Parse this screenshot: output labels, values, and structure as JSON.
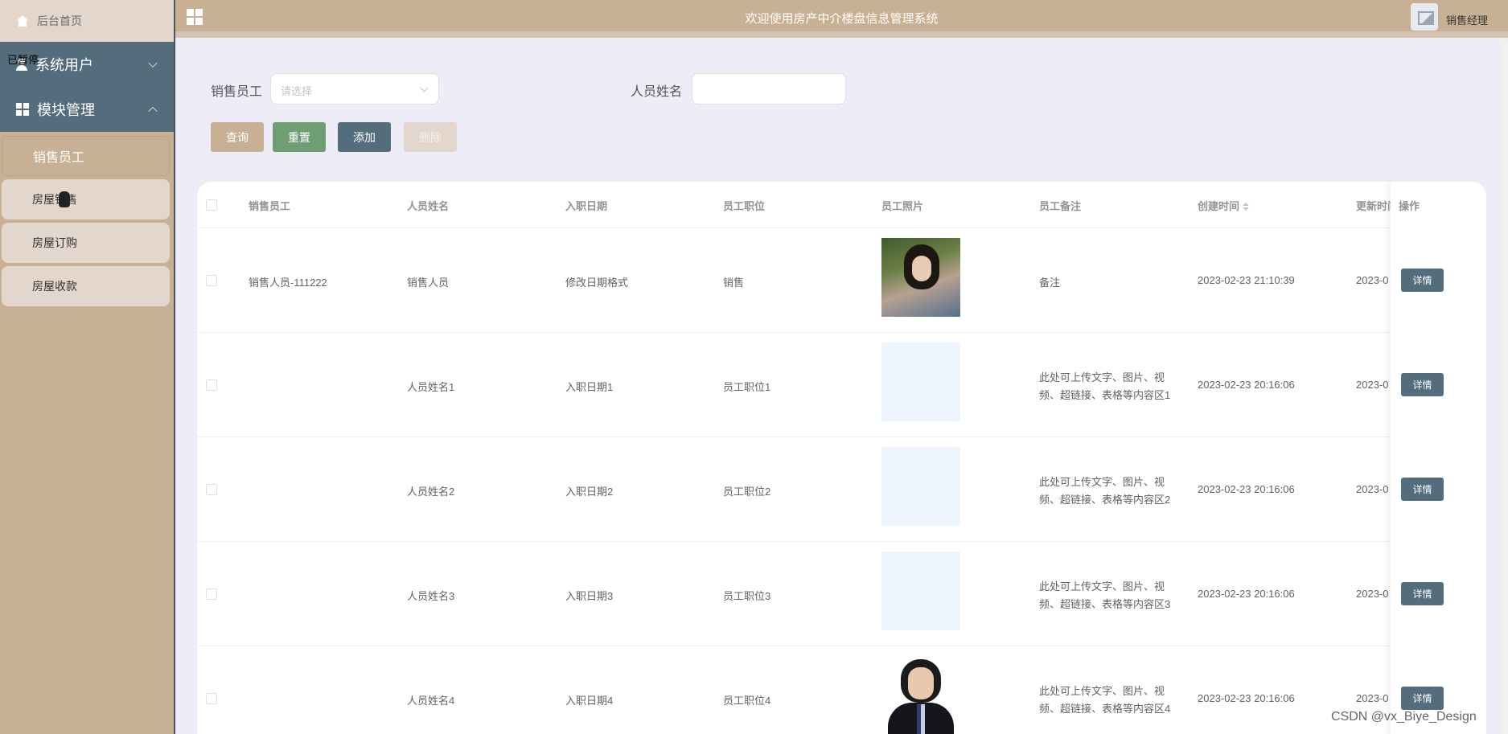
{
  "sidebar": {
    "home": "后台首页",
    "paused": "已暂停",
    "groups": [
      {
        "label": "系统用户"
      },
      {
        "label": "模块管理"
      }
    ],
    "items": [
      {
        "label": "销售员工"
      },
      {
        "label": "房屋销售"
      },
      {
        "label": "房屋订购"
      },
      {
        "label": "房屋收款"
      }
    ]
  },
  "header": {
    "title": "欢迎使用房产中介楼盘信息管理系统",
    "role": "销售经理"
  },
  "filters": {
    "staff_label": "销售员工",
    "staff_placeholder": "请选择",
    "name_label": "人员姓名",
    "name_value": ""
  },
  "buttons": {
    "query": "查询",
    "reset": "重置",
    "add": "添加",
    "delete": "删除"
  },
  "table": {
    "headers": [
      "销售员工",
      "人员姓名",
      "入职日期",
      "员工职位",
      "员工照片",
      "员工备注",
      "创建时间",
      "更新时间",
      "操作"
    ],
    "rows": [
      {
        "staff": "销售人员-111222",
        "name": "销售人员",
        "date": "修改日期格式",
        "position": "销售",
        "photo": "photo-girl",
        "note1": "备注",
        "note2": "",
        "created": "2023-02-23 21:10:39",
        "updated": "2023-0",
        "action": "详情"
      },
      {
        "staff": "",
        "name": "人员姓名1",
        "date": "入职日期1",
        "position": "员工职位1",
        "photo": "photo-empty",
        "note1": "此处可上传文字、图片、视",
        "note2": "频、超链接、表格等内容区1",
        "created": "2023-02-23 20:16:06",
        "updated": "2023-0",
        "action": "详情"
      },
      {
        "staff": "",
        "name": "人员姓名2",
        "date": "入职日期2",
        "position": "员工职位2",
        "photo": "photo-empty",
        "note1": "此处可上传文字、图片、视",
        "note2": "频、超链接、表格等内容区2",
        "created": "2023-02-23 20:16:06",
        "updated": "2023-0",
        "action": "详情"
      },
      {
        "staff": "",
        "name": "人员姓名3",
        "date": "入职日期3",
        "position": "员工职位3",
        "photo": "photo-empty",
        "note1": "此处可上传文字、图片、视",
        "note2": "频、超链接、表格等内容区3",
        "created": "2023-02-23 20:16:06",
        "updated": "2023-0",
        "action": "详情"
      },
      {
        "staff": "",
        "name": "人员姓名4",
        "date": "入职日期4",
        "position": "员工职位4",
        "photo": "photo-boy",
        "note1": "此处可上传文字、图片、视",
        "note2": "频、超链接、表格等内容区4",
        "created": "2023-02-23 20:16:06",
        "updated": "2023-0",
        "action": "详情"
      }
    ]
  },
  "watermark": "CSDN @vx_Biye_Design",
  "colors": {
    "accent_tan": "#c8b095",
    "slate": "#536d7c",
    "green": "#6f9e75",
    "background": "#eeecf6"
  }
}
